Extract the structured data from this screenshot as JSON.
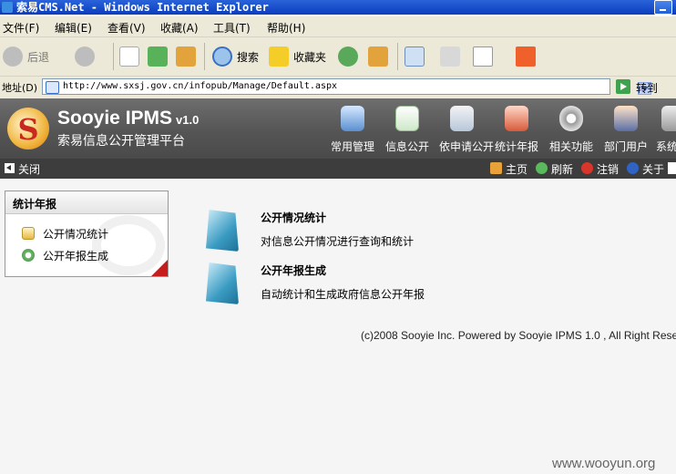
{
  "window": {
    "title": "索易CMS.Net - Windows Internet Explorer"
  },
  "menu": [
    "文件(F)",
    "编辑(E)",
    "查看(V)",
    "收藏(A)",
    "工具(T)",
    "帮助(H)"
  ],
  "toolbar": {
    "back_label": "后退",
    "search_label": "搜索",
    "favorites_label": "收藏夹"
  },
  "address": {
    "label": "地址(D)",
    "url": "http://www.sxsj.gov.cn/infopub/Manage/Default.aspx",
    "go_label": "转到"
  },
  "app": {
    "brand_name": "Sooyie IPMS",
    "brand_version": "v1.0",
    "brand_subtitle": "索易信息公开管理平台",
    "nav": [
      "常用管理",
      "信息公开",
      "依申请公开",
      "统计年报",
      "相关功能",
      "部门用户",
      "系统"
    ]
  },
  "subbar": {
    "close_label": "关闭",
    "home_label": "主页",
    "refresh_label": "刷新",
    "logout_label": "注销",
    "about_label": "关于"
  },
  "sidebar": {
    "title": "统计年报",
    "items": [
      "公开情况统计",
      "公开年报生成"
    ]
  },
  "features": [
    {
      "title": "公开情况统计",
      "desc": "对信息公开情况进行查询和统计"
    },
    {
      "title": "公开年报生成",
      "desc": "自动统计和生成政府信息公开年报"
    }
  ],
  "footer": "(c)2008 Sooyie Inc. Powered by Sooyie IPMS 1.0 , All Right Rese",
  "watermark": "www.wooyun.org",
  "colors": {
    "titlebar": "#0a3dbd",
    "header_bg": "#555555",
    "subbar_bg": "#3d3d3d",
    "accent_red": "#c81d1d"
  }
}
